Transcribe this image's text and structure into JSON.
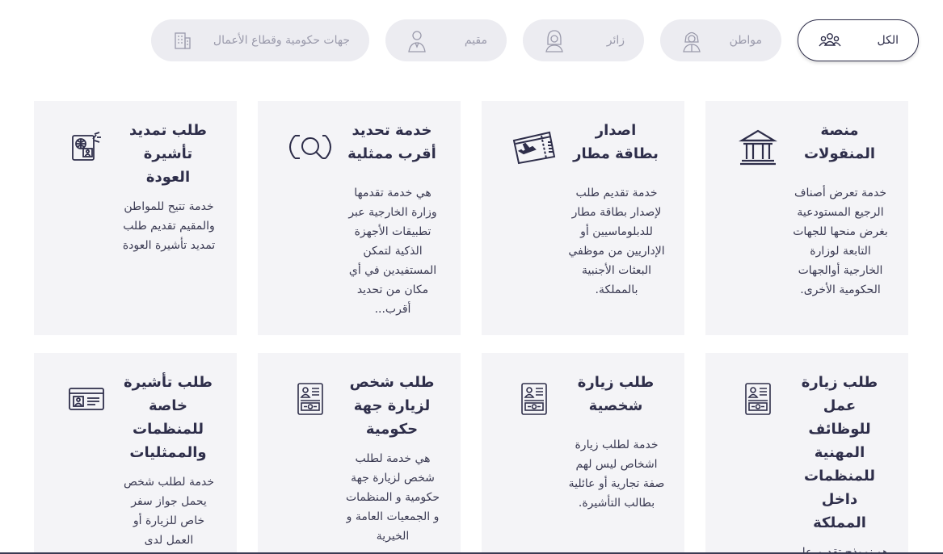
{
  "filters": [
    {
      "label": "الكل",
      "icon": "group-icon",
      "active": true
    },
    {
      "label": "مواطن",
      "icon": "citizen-icon",
      "active": false
    },
    {
      "label": "زائر",
      "icon": "visitor-icon",
      "active": false
    },
    {
      "label": "مقيم",
      "icon": "resident-icon",
      "active": false
    },
    {
      "label": "جهات حكومية وقطاع الأعمال",
      "icon": "building-icon",
      "active": false
    }
  ],
  "cards": [
    {
      "title": "منصة المنقولات",
      "icon": "bank-icon",
      "description": "خدمة تعرض أصناف الرجيع المستودعية بغرض منحها للجهات التابعة لوزارة الخارجية أوالجهات الحكومية الأخرى."
    },
    {
      "title": "اصدار بطاقة مطار",
      "icon": "airport-ticket-icon",
      "description": "خدمة تقديم طلب لإصدار بطاقة مطار للدبلوماسيين أو الإداريين من موظفي البعثات الأجنبية بالمملكة."
    },
    {
      "title": "خدمة تحديد أقرب ممثلية",
      "icon": "locate-search-icon",
      "description": "هي خدمة تقدمها وزارة الخارجية عبر تطبيقات الأجهزة الذكية لتمكن المستفيدين في أي مكان من تحديد أقرب..."
    },
    {
      "title": "طلب تمديد تأشيرة العودة",
      "icon": "passport-visa-icon",
      "description": "خدمة تتيح للمواطن والمقيم تقديم طلب تمديد تأشيرة العودة"
    },
    {
      "title": "طلب زيارة عمل للوظائف المهنية للمنظمات داخل المملكة",
      "icon": "visa-form-icon",
      "description": "هو نموذج تقديم على تأشيرة عمل"
    },
    {
      "title": "طلب زيارة شخصية",
      "icon": "visa-form-icon",
      "description": "خدمة لطلب زيارة اشخاص ليس لهم صفة تجارية أو عائلية بطالب التأشيرة."
    },
    {
      "title": "طلب شخص لزيارة جهة حكومية",
      "icon": "visa-form-icon",
      "description": "هي خدمة لطلب شخص لزيارة جهة حكومية و المنظمات و الجمعيات العامة و الخيرية"
    },
    {
      "title": "طلب تأشيرة خاصة للمنظمات والممثليات",
      "icon": "id-card-icon",
      "description": "خدمة لطلب شخص يحمل جواز سفر خاص للزيارة أو العمل لدى المنظمات"
    }
  ],
  "colors": {
    "primary": "#2e2e4a",
    "pill_inactive_bg": "#ececf1",
    "pill_inactive_text": "#9a9aab",
    "card_bg": "#f4f4f7"
  }
}
